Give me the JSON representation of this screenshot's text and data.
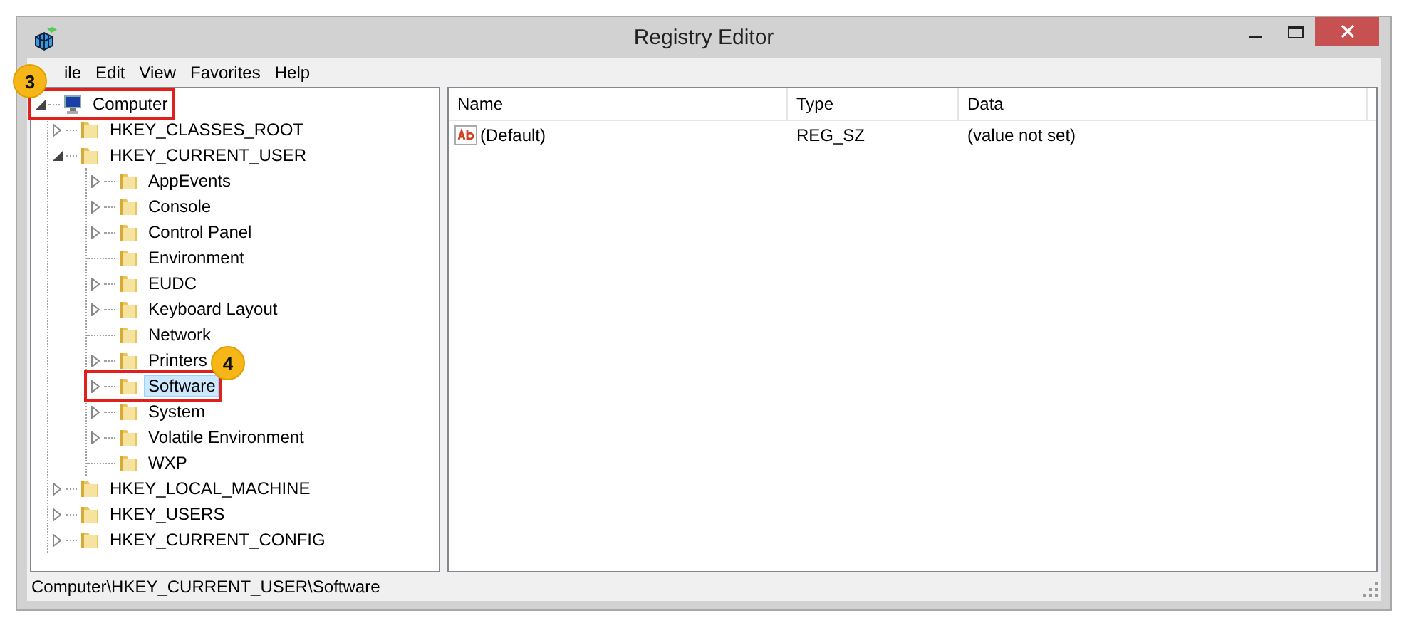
{
  "window": {
    "title": "Registry Editor"
  },
  "menu": [
    "ile",
    "Edit",
    "View",
    "Favorites",
    "Help"
  ],
  "tree": [
    {
      "label": "Computer",
      "kind": "computer",
      "expanded": true,
      "selected": false,
      "highlighted": true,
      "children": [
        {
          "label": "HKEY_CLASSES_ROOT",
          "kind": "folder",
          "expanded": false,
          "selected": false,
          "highlighted": false
        },
        {
          "label": "HKEY_CURRENT_USER",
          "kind": "folder",
          "expanded": true,
          "selected": false,
          "highlighted": false,
          "children": [
            {
              "label": "AppEvents",
              "kind": "folder",
              "expanded": false,
              "selected": false,
              "highlighted": false
            },
            {
              "label": "Console",
              "kind": "folder",
              "expanded": false,
              "selected": false,
              "highlighted": false
            },
            {
              "label": "Control Panel",
              "kind": "folder",
              "expanded": false,
              "selected": false,
              "highlighted": false
            },
            {
              "label": "Environment",
              "kind": "folder",
              "selected": false,
              "highlighted": false
            },
            {
              "label": "EUDC",
              "kind": "folder",
              "expanded": false,
              "selected": false,
              "highlighted": false
            },
            {
              "label": "Keyboard Layout",
              "kind": "folder",
              "expanded": false,
              "selected": false,
              "highlighted": false
            },
            {
              "label": "Network",
              "kind": "folder",
              "selected": false,
              "highlighted": false
            },
            {
              "label": "Printers",
              "kind": "folder",
              "expanded": false,
              "selected": false,
              "highlighted": false
            },
            {
              "label": "Software",
              "kind": "folder",
              "expanded": false,
              "selected": true,
              "highlighted": true
            },
            {
              "label": "System",
              "kind": "folder",
              "expanded": false,
              "selected": false,
              "highlighted": false
            },
            {
              "label": "Volatile Environment",
              "kind": "folder",
              "expanded": false,
              "selected": false,
              "highlighted": false
            },
            {
              "label": "WXP",
              "kind": "folder",
              "selected": false,
              "highlighted": false
            }
          ]
        },
        {
          "label": "HKEY_LOCAL_MACHINE",
          "kind": "folder",
          "expanded": false,
          "selected": false,
          "highlighted": false
        },
        {
          "label": "HKEY_USERS",
          "kind": "folder",
          "expanded": false,
          "selected": false,
          "highlighted": false
        },
        {
          "label": "HKEY_CURRENT_CONFIG",
          "kind": "folder",
          "expanded": false,
          "selected": false,
          "highlighted": false
        }
      ]
    }
  ],
  "table": {
    "columns": [
      "Name",
      "Type",
      "Data"
    ],
    "rows": [
      {
        "name": "(Default)",
        "type": "REG_SZ",
        "data": "(value not set)"
      }
    ]
  },
  "status_bar": "Computer\\HKEY_CURRENT_USER\\Software",
  "annotations": [
    {
      "label": "3"
    },
    {
      "label": "4"
    }
  ]
}
